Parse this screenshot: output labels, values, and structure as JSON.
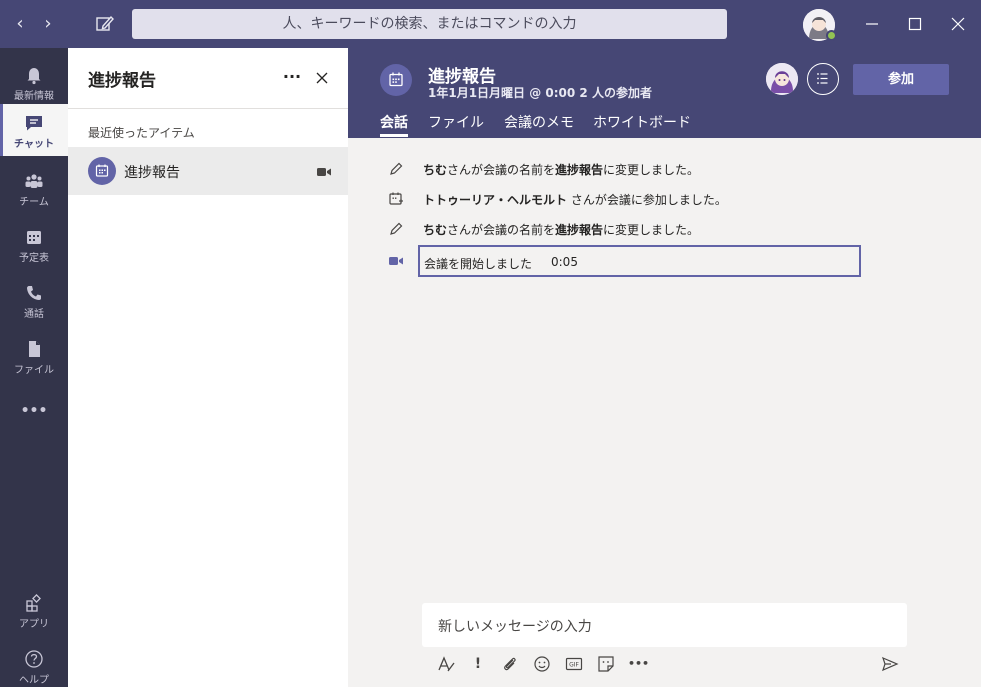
{
  "titlebar": {
    "back_glyph": "‹",
    "forward_glyph": "›",
    "search_placeholder": "人、キーワードの検索、またはコマンドの入力"
  },
  "rail": {
    "items": [
      {
        "label": "最新情報",
        "icon": "bell-icon"
      },
      {
        "label": "チャット",
        "icon": "chat-icon",
        "active": true
      },
      {
        "label": "チーム",
        "icon": "teams-icon"
      },
      {
        "label": "予定表",
        "icon": "calendar-icon"
      },
      {
        "label": "通話",
        "icon": "phone-icon"
      },
      {
        "label": "ファイル",
        "icon": "file-icon"
      }
    ],
    "more": "•••",
    "bottom": [
      {
        "label": "アプリ",
        "icon": "apps-icon"
      },
      {
        "label": "ヘルプ",
        "icon": "help-icon"
      }
    ]
  },
  "list_pane": {
    "title": "進捗報告",
    "more": "···",
    "section_label": "最近使ったアイテム",
    "items": [
      {
        "label": "進捗報告",
        "icon": "meeting-icon",
        "trailing_icon": "video-camera-icon"
      }
    ]
  },
  "meeting": {
    "title": "進捗報告",
    "subtitle": "1年1月1日月曜日 @ 0:00 2 人の参加者",
    "join_label": "参加",
    "tabs": [
      {
        "label": "会話",
        "active": true
      },
      {
        "label": "ファイル"
      },
      {
        "label": "会議のメモ"
      },
      {
        "label": "ホワイトボード"
      }
    ]
  },
  "messages": [
    {
      "icon": "pencil-icon",
      "actor": "ちむ",
      "text_a": "さんが会議の名前を",
      "target": "進捗報告",
      "text_b": "に変更しました。"
    },
    {
      "icon": "calendar-add-icon",
      "actor": "トトゥーリア・ヘルモルト",
      "text_a": " さんが会議に参加しました。"
    },
    {
      "icon": "pencil-icon",
      "actor": "ちむ",
      "text_a": "さんが会議の名前を",
      "target": "進捗報告",
      "text_b": "に変更しました。"
    },
    {
      "icon": "video-camera-icon",
      "text": "会議を開始しました",
      "duration": "0:05"
    }
  ],
  "compose": {
    "placeholder": "新しいメッセージの入力",
    "tools": [
      "format-icon",
      "important-icon",
      "attach-icon",
      "emoji-icon",
      "gif-icon",
      "sticker-icon",
      "more-icon",
      "send-icon"
    ],
    "important_glyph": "!",
    "more_glyph": "•••",
    "gif_text": "GIF"
  },
  "colors": {
    "titlebar": "#464775",
    "rail": "#33344a",
    "accent": "#6264a7",
    "presence": "#92c353"
  }
}
